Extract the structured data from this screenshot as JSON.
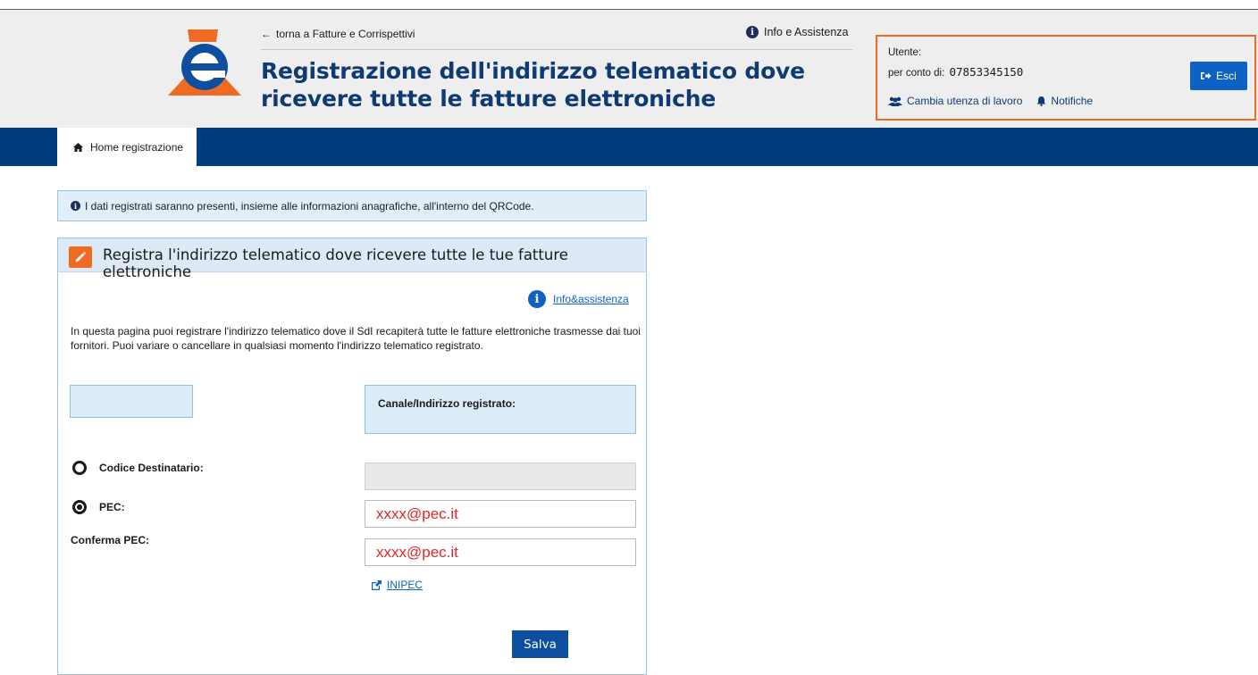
{
  "header": {
    "back_link": "torna a Fatture e Corrispettivi",
    "info": "Info e Assistenza",
    "title": "Registrazione dell'indirizzo telematico dove ricevere tutte le fatture elettroniche"
  },
  "user": {
    "label": "Utente:",
    "conto_label": "per conto di:",
    "conto_value": "07853345150",
    "change": "Cambia utenza di lavoro",
    "notifications": "Notifiche",
    "logout": "Esci"
  },
  "nav": {
    "home": "Home registrazione"
  },
  "alert": "I dati registrati saranno presenti, insieme alle informazioni anagrafiche, all'interno del QRCode.",
  "panel": {
    "title": "Registra l'indirizzo telematico dove ricevere tutte le tue fatture elettroniche",
    "info_link": "Info&assistenza",
    "description": "In questa pagina puoi registrare l'indirizzo telematico dove il SdI recapiterà tutte le fatture elettroniche trasmesse dai tuoi fornitori. Puoi variare o cancellare in qualsiasi momento l'indirizzo telematico registrato.",
    "canale_label": "Canale/Indirizzo registrato:",
    "codice_label": "Codice Destinatario:",
    "codice_value": "",
    "pec_label": "PEC:",
    "pec_value": "xxxx@pec.it",
    "conferma_label": "Conferma PEC:",
    "conferma_value": "xxxx@pec.it",
    "inipec_link": "INIPEC",
    "save_button": "Salva",
    "selected_channel": "PEC"
  },
  "colors": {
    "brand_blue": "#003d7c",
    "title_blue": "#0f3b72",
    "accent_orange": "#ef6a22",
    "button_blue": "#0d62c3",
    "input_text_red": "#e0282a"
  }
}
